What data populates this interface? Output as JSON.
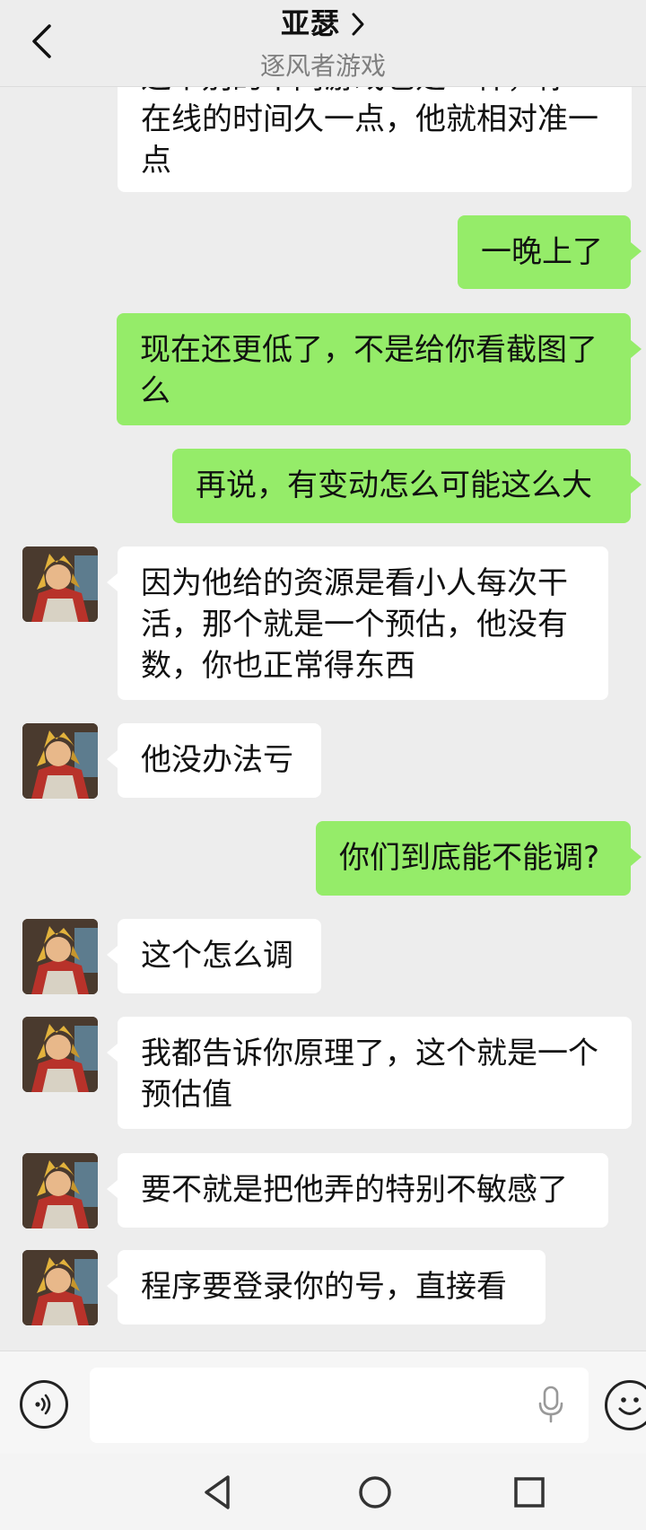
{
  "header": {
    "title": "亚瑟",
    "subtitle": "逐风者游戏"
  },
  "messages": [
    {
      "side": "in",
      "text": "这个别的不同游戏也是一样，你\n在线的时间久一点，他就相对准一\n点"
    },
    {
      "side": "out",
      "text": "一晚上了"
    },
    {
      "side": "out",
      "text": "现在还更低了，不是给你看截图了\n么"
    },
    {
      "side": "out",
      "text": "再说，有变动怎么可能这么大"
    },
    {
      "side": "in",
      "text": "因为他给的资源是看小人每次干\n活，那个就是一个预估，他没有\n数，你也正常得东西"
    },
    {
      "side": "in",
      "text": "他没办法亏"
    },
    {
      "side": "out",
      "text": "你们到底能不能调?"
    },
    {
      "side": "in",
      "text": "这个怎么调"
    },
    {
      "side": "in",
      "text": "我都告诉你原理了，这个就是一个\n预估值"
    },
    {
      "side": "in",
      "text": "要不就是把他弄的特别不敏感了"
    },
    {
      "side": "in",
      "text": "程序要登录你的号，直接看"
    }
  ],
  "input": {
    "value": "",
    "placeholder": ""
  },
  "colors": {
    "sent_bubble": "#95ec69",
    "received_bubble": "#ffffff",
    "background": "#ededed"
  },
  "icons": {
    "back": "chevron-left-icon",
    "title_more": "chevron-right-icon",
    "voice": "voice-icon",
    "mic": "microphone-icon",
    "emoji": "emoji-icon",
    "nav_back": "triangle-back-icon",
    "nav_home": "circle-home-icon",
    "nav_recent": "square-recent-icon"
  }
}
